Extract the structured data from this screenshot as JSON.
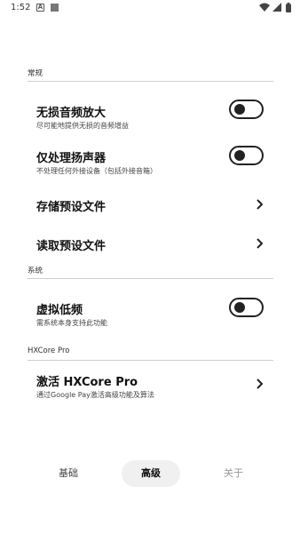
{
  "status_bar": {
    "time": "1:52",
    "notif_icon_letter": "A",
    "icons": [
      "notification-icon",
      "image-icon",
      "wifi-icon",
      "signal-icon",
      "battery-icon"
    ]
  },
  "sections": {
    "general": {
      "header": "常规",
      "lossless": {
        "title": "无损音频放大",
        "subtitle": "尽可能地提供无损的音频增益",
        "enabled": false
      },
      "speaker": {
        "title": "仅处理扬声器",
        "subtitle": "不处理任何外接设备（包括外接音箱）",
        "enabled": false
      },
      "save_preset": {
        "title": "存储预设文件"
      },
      "load_preset": {
        "title": "读取预设文件"
      }
    },
    "system": {
      "header": "系统",
      "virtual_bass": {
        "title": "虚拟低频",
        "subtitle": "需系统本身支持此功能",
        "enabled": false
      }
    },
    "pro": {
      "header": "HXCore Pro",
      "activate": {
        "title": "激活 HXCore Pro",
        "subtitle": "通过Google Pay激活高级功能及算法"
      }
    }
  },
  "bottom_nav": {
    "basic": "基础",
    "advanced": "高级",
    "about": "关于",
    "selected": "advanced"
  },
  "colors": {
    "toggle_stroke": "#222222",
    "divider": "#cfcfcf",
    "nav_selected_bg": "#f0f0f0"
  }
}
